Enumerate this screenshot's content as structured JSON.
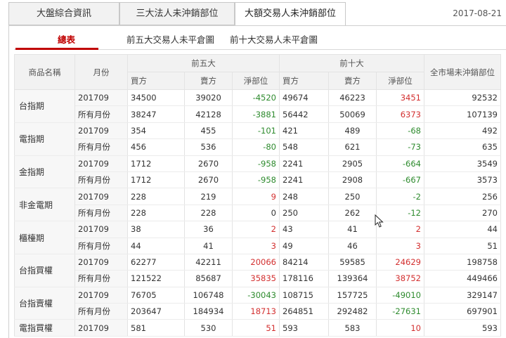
{
  "tabs": [
    "大盤綜合資訊",
    "三大法人未沖銷部位",
    "大額交易人未沖銷部位"
  ],
  "date": "2017-08-21",
  "sub_tabs": [
    "總表",
    "前五大交易人未平倉圖",
    "前十大交易人未平倉圖"
  ],
  "headers": {
    "product": "商品名稱",
    "month": "月份",
    "top5": "前五大",
    "top10": "前十大",
    "market": "全市場未沖銷部位",
    "buy": "買方",
    "sell": "賣方",
    "net": "淨部位"
  },
  "rows": [
    {
      "name": "台指期",
      "lines": [
        [
          "201709",
          "34500",
          "39020",
          "-4520",
          "49674",
          "46223",
          "3451",
          "92532"
        ],
        [
          "所有月份",
          "38247",
          "42128",
          "-3881",
          "56442",
          "50069",
          "6373",
          "107139"
        ]
      ]
    },
    {
      "name": "電指期",
      "lines": [
        [
          "201709",
          "354",
          "455",
          "-101",
          "421",
          "489",
          "-68",
          "492"
        ],
        [
          "所有月份",
          "456",
          "536",
          "-80",
          "548",
          "621",
          "-73",
          "635"
        ]
      ]
    },
    {
      "name": "金指期",
      "lines": [
        [
          "201709",
          "1712",
          "2670",
          "-958",
          "2241",
          "2905",
          "-664",
          "3549"
        ],
        [
          "所有月份",
          "1712",
          "2670",
          "-958",
          "2241",
          "2908",
          "-667",
          "3573"
        ]
      ]
    },
    {
      "name": "非金電期",
      "lines": [
        [
          "201709",
          "228",
          "219",
          "9",
          "248",
          "250",
          "-2",
          "256"
        ],
        [
          "所有月份",
          "228",
          "228",
          "0",
          "250",
          "262",
          "-12",
          "270"
        ]
      ]
    },
    {
      "name": "櫃檯期",
      "lines": [
        [
          "201709",
          "38",
          "36",
          "2",
          "43",
          "41",
          "2",
          "44"
        ],
        [
          "所有月份",
          "44",
          "41",
          "3",
          "49",
          "46",
          "3",
          "51"
        ]
      ]
    },
    {
      "name": "台指買權",
      "lines": [
        [
          "201709",
          "62277",
          "42211",
          "20066",
          "84214",
          "59585",
          "24629",
          "198758"
        ],
        [
          "所有月份",
          "121522",
          "85687",
          "35835",
          "178116",
          "139364",
          "38752",
          "449466"
        ]
      ]
    },
    {
      "name": "台指賣權",
      "lines": [
        [
          "201709",
          "76705",
          "106748",
          "-30043",
          "108715",
          "157725",
          "-49010",
          "329147"
        ],
        [
          "所有月份",
          "203647",
          "184934",
          "18713",
          "264851",
          "292482",
          "-27631",
          "697901"
        ]
      ]
    },
    {
      "name": "電指買權",
      "lines": [
        [
          "201709",
          "581",
          "530",
          "51",
          "593",
          "583",
          "10",
          "593"
        ]
      ]
    }
  ],
  "colors": {
    "positive": "#d32f2f",
    "negative": "#2e8b2e",
    "accent": "#c00000"
  }
}
